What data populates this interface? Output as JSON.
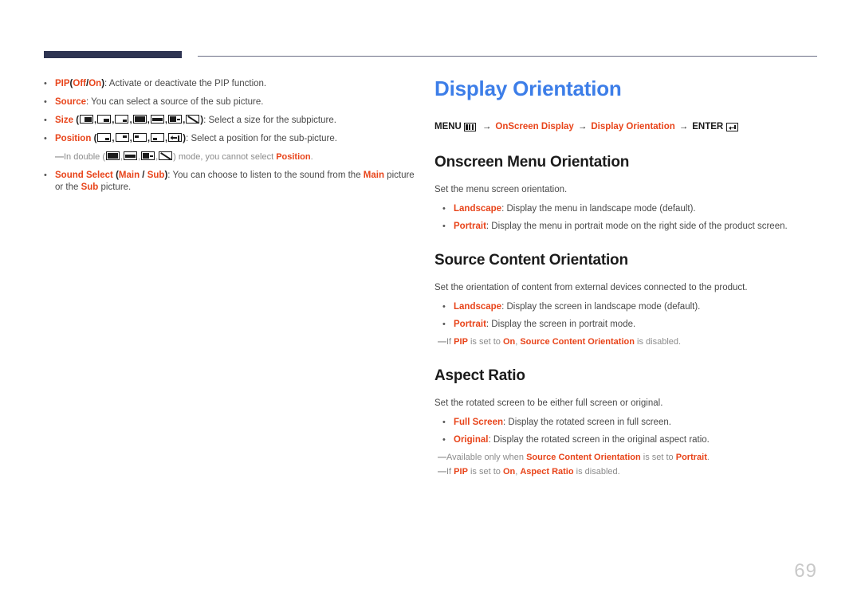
{
  "header": {
    "tab_color": "#2e3452",
    "line_color": "#6b6e86"
  },
  "page_number": "69",
  "colors": {
    "title_blue": "#3d7ee8",
    "keyword_orange": "#e8441a",
    "body_gray": "#4a4a4a",
    "note_gray": "#8b8b8b",
    "page_number_gray": "#c9c9c9"
  },
  "left_column": {
    "items": [
      {
        "kind": "bullet",
        "label": "PIP",
        "options_open": "(",
        "options": [
          "Off",
          "/",
          "On"
        ],
        "options_close": ")",
        "text": ": Activate or deactivate the PIP function."
      },
      {
        "kind": "bullet",
        "label": "Source",
        "text": ": You can select a source of the sub picture."
      },
      {
        "kind": "bullet-icons",
        "label": "Size",
        "icons": [
          "pip-size-large-icon",
          "pip-size-medium-icon",
          "pip-size-small-icon",
          "pip-double-half-icon",
          "pip-double-wide-icon",
          "pip-double-dash-icon",
          "pip-double-diagonal-icon"
        ],
        "text": ": Select a size for the subpicture."
      },
      {
        "kind": "bullet-icons",
        "label": "Position",
        "icons": [
          "pip-pos-bottom-right-icon",
          "pip-pos-top-right-icon",
          "pip-pos-top-left-icon",
          "pip-pos-bottom-left-icon",
          "pip-pos-arrow-icon"
        ],
        "text": ": Select a position for the sub-picture."
      },
      {
        "kind": "note-icons",
        "pre": "In double (",
        "icons": [
          "pip-double-half-icon",
          "pip-double-wide-icon",
          "pip-double-dash-icon",
          "pip-double-diagonal-icon"
        ],
        "mid": ") mode, you cannot select ",
        "keyword": "Position",
        "post": "."
      },
      {
        "kind": "bullet",
        "label": "Sound Select",
        "options_open": "(",
        "options": [
          "Main",
          "/",
          "Sub"
        ],
        "options_close": ")",
        "text": ": You can choose to listen to the sound from the ",
        "kw2": "Main",
        "text2": " picture or the ",
        "kw3": "Sub",
        "text3": " picture."
      }
    ]
  },
  "right_column": {
    "title": "Display Orientation",
    "breadcrumb": {
      "menu_label": "MENU",
      "menu_icon": "menu-icon",
      "arrow": "→",
      "crumb1": "OnScreen Display",
      "crumb2": "Display Orientation",
      "enter_label": "ENTER",
      "enter_icon": "enter-icon"
    },
    "sections": [
      {
        "heading": "Onscreen Menu Orientation",
        "description": "Set the menu screen orientation.",
        "bullets": [
          {
            "keyword": "Landscape",
            "text": ": Display the menu in landscape mode (default)."
          },
          {
            "keyword": "Portrait",
            "text": ": Display the menu in portrait mode on the right side of the product screen."
          }
        ],
        "notes": []
      },
      {
        "heading": "Source Content Orientation",
        "description": "Set the orientation of content from external devices connected to the product.",
        "bullets": [
          {
            "keyword": "Landscape",
            "text": ": Display the screen in landscape mode (default)."
          },
          {
            "keyword": "Portrait",
            "text": ": Display the screen in portrait mode."
          }
        ],
        "notes": [
          {
            "pre": "If ",
            "kw1": "PIP",
            "mid": " is set to ",
            "kw2": "On",
            "mid2": ", ",
            "kw3": "Source Content Orientation",
            "post": " is disabled."
          }
        ]
      },
      {
        "heading": "Aspect Ratio",
        "description": "Set the rotated screen to be either full screen or original.",
        "bullets": [
          {
            "keyword": "Full Screen",
            "text": ": Display the rotated screen in full screen."
          },
          {
            "keyword": "Original",
            "text": ": Display the rotated screen in the original aspect ratio."
          }
        ],
        "notes": [
          {
            "pre": "Available only when ",
            "kw1": "Source Content Orientation",
            "mid": " is set to ",
            "kw2": "Portrait",
            "mid2": "",
            "kw3": "",
            "post": "."
          },
          {
            "pre": "If ",
            "kw1": "PIP",
            "mid": " is set to ",
            "kw2": "On",
            "mid2": ", ",
            "kw3": "Aspect Ratio",
            "post": " is disabled."
          }
        ]
      }
    ]
  }
}
